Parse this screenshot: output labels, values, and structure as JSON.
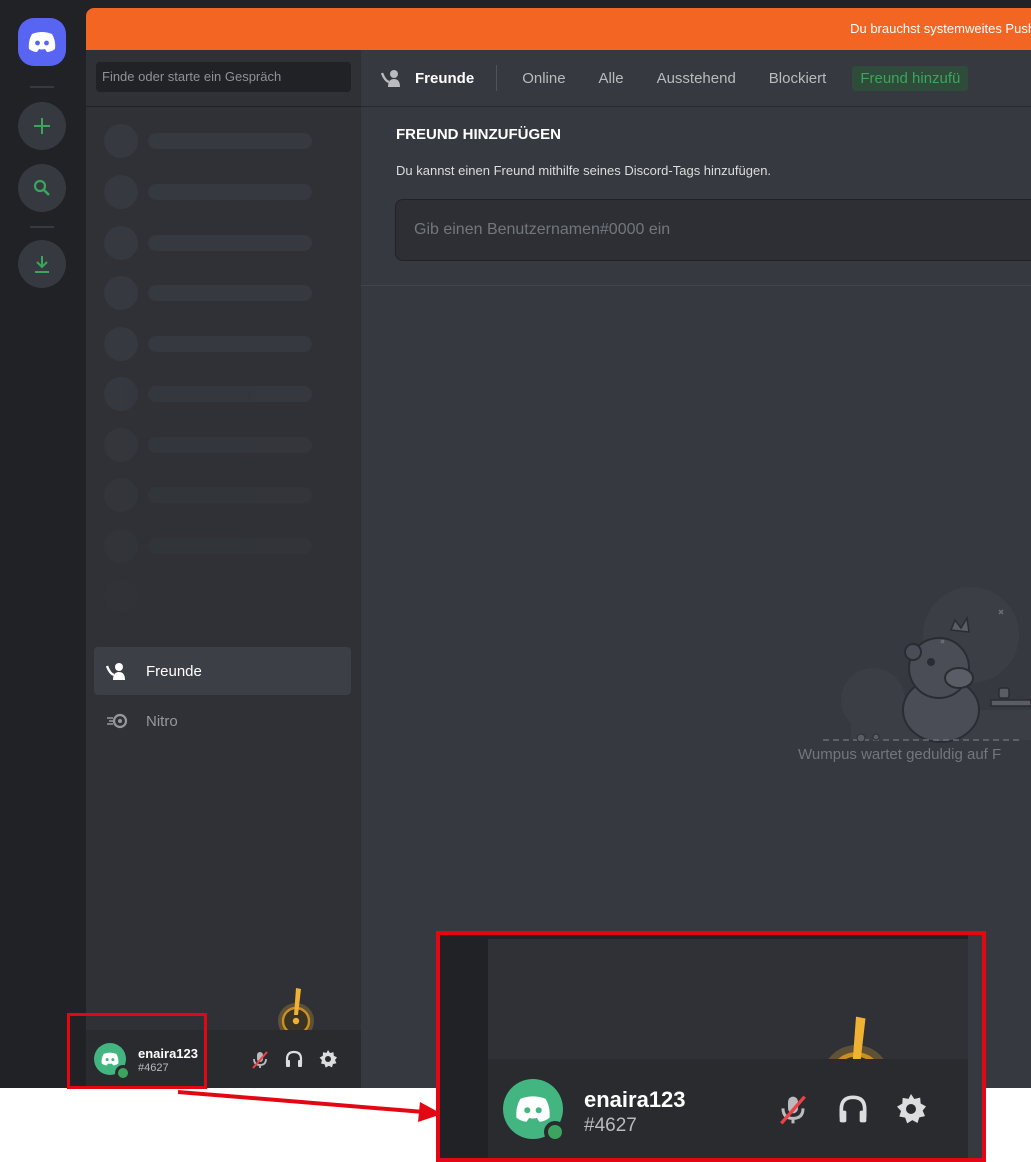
{
  "banner": {
    "text": "Du brauchst systemweites Push-t"
  },
  "search": {
    "placeholder": "Finde oder starte ein Gespräch"
  },
  "tabs": {
    "friends": "Freunde",
    "online": "Online",
    "all": "Alle",
    "pending": "Ausstehend",
    "blocked": "Blockiert",
    "add_friend": "Freund hinzufü"
  },
  "add_friend": {
    "title": "FREUND HINZUFÜGEN",
    "description": "Du kannst einen Freund mithilfe seines Discord-Tags hinzufügen.",
    "input_placeholder": "Gib einen Benutzernamen#0000 ein"
  },
  "nav": {
    "friends": "Freunde",
    "nitro": "Nitro"
  },
  "empty_state": {
    "text": "Wumpus wartet geduldig auf F"
  },
  "user": {
    "name": "enaira123",
    "tag": "#4627"
  },
  "colors": {
    "accent": "#5865f2",
    "banner": "#f26522",
    "online": "#3ba55d",
    "highlight": "#e30613",
    "warning": "#f0b232"
  },
  "icons": {
    "home": "discord-logo-icon",
    "add_server": "plus-icon",
    "explore": "search-icon",
    "download": "download-icon",
    "friends": "friends-wave-icon",
    "nitro": "nitro-icon",
    "mute": "microphone-muted-icon",
    "deafen": "headphones-icon",
    "settings": "gear-icon",
    "warning": "exclamation-warning-icon"
  }
}
